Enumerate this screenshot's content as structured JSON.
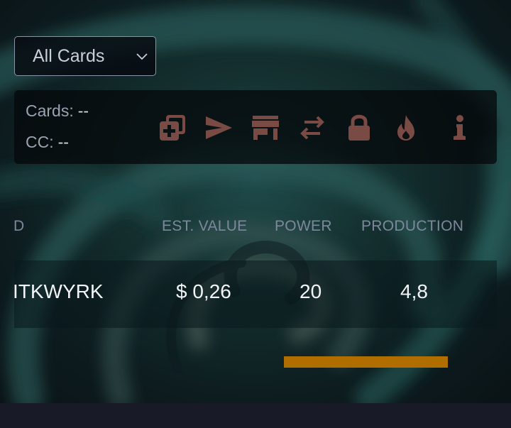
{
  "filter": {
    "selected": "All Cards"
  },
  "stats": {
    "cards_label": "Cards:",
    "cards_value": "--",
    "cc_label": "CC:",
    "cc_value": "--"
  },
  "toolbar": {
    "icons": [
      "add-cards-icon",
      "send-icon",
      "market-icon",
      "transfer-icon",
      "lock-icon",
      "burn-icon",
      "info-icon"
    ],
    "icon_color": "#7a4a45"
  },
  "table": {
    "headers": {
      "id": "D",
      "value": "EST. VALUE",
      "power": "POWER",
      "production": "PRODUCTION"
    },
    "rows": [
      {
        "id": "ITKWYRK",
        "value": "$ 0,26",
        "power": "20",
        "production": "4,8"
      }
    ]
  },
  "progress": {
    "fraction": 1.0,
    "color": "#b06d00"
  }
}
